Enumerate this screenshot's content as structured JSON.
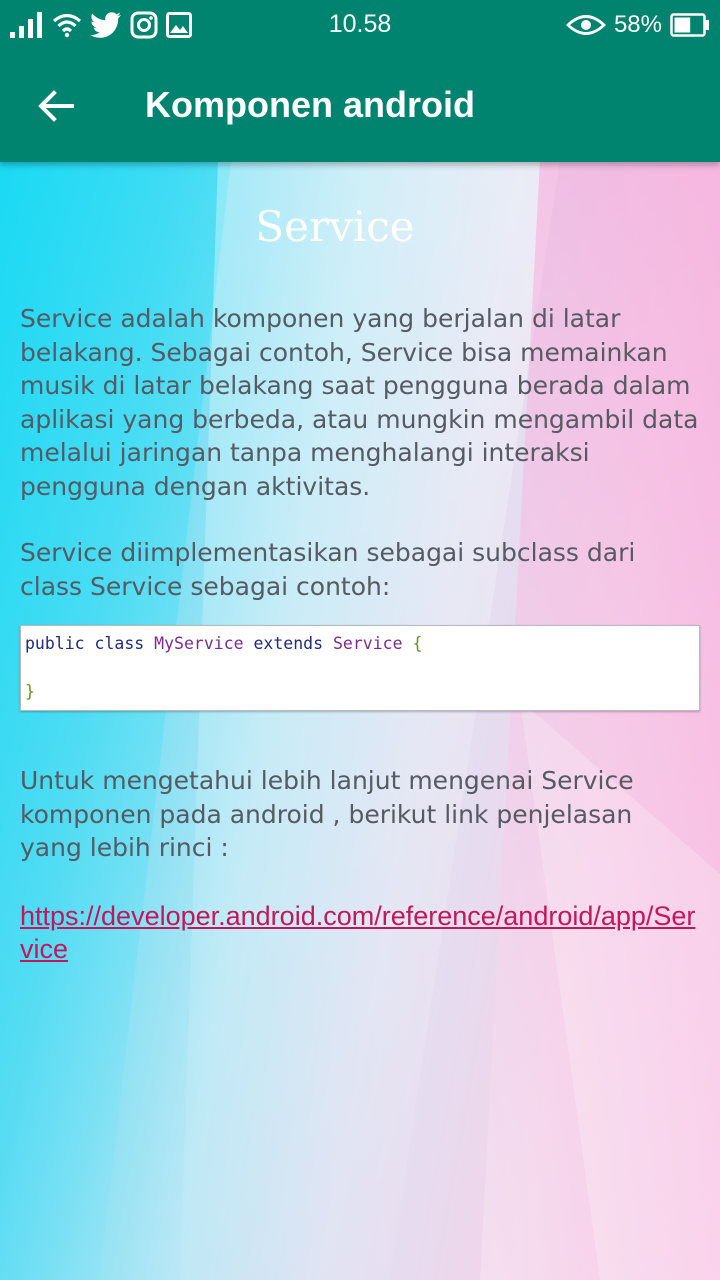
{
  "status_bar": {
    "time": "10.58",
    "battery_percent": "58%",
    "battery_level": 0.58,
    "left_icons": [
      "signal-icon",
      "wifi-icon",
      "twitter-icon",
      "instagram-icon",
      "image-icon"
    ],
    "right_icons": [
      "eye-icon",
      "battery-icon"
    ]
  },
  "app_bar": {
    "title": "Komponen android",
    "back_icon": "arrow-left-icon",
    "color": "#00846f"
  },
  "content": {
    "section_title": "Service",
    "paragraph_1": "Service adalah komponen yang berjalan di latar belakang. Sebagai contoh, Service bisa memainkan musik di latar belakang saat pengguna berada dalam aplikasi yang berbeda, atau mungkin mengambil data melalui jaringan tanpa menghalangi interaksi pengguna dengan aktivitas.",
    "paragraph_2": "Service diimplementasikan sebagai subclass dari class Service sebagai contoh:",
    "code": {
      "kw_public": "public",
      "kw_class": "class",
      "class_name": "MyService",
      "kw_extends": "extends",
      "parent_class": "Service",
      "open_brace": "{",
      "close_brace": "}"
    },
    "paragraph_3": "Untuk mengetahui lebih lanjut mengenai Service komponen pada android , berikut link penjelasan yang lebih rinci :",
    "link_text": "https://developer.android.com/reference/android/app/Service"
  }
}
